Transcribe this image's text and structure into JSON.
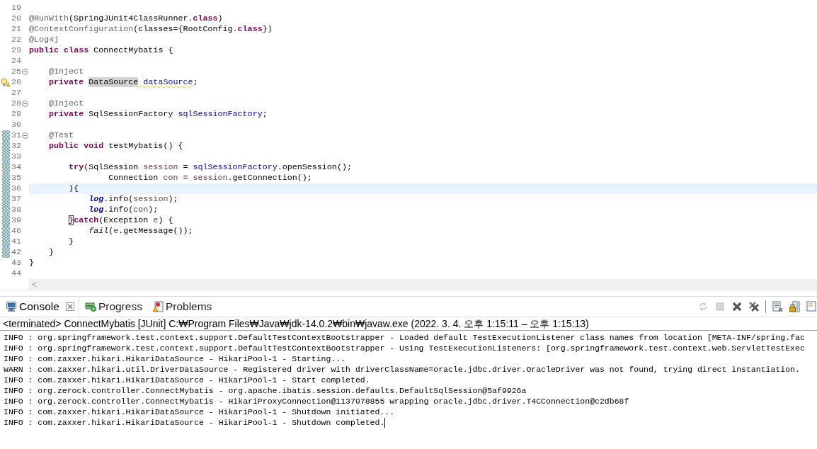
{
  "editor": {
    "lines": [
      {
        "number": "19",
        "kind": "plain",
        "changed": false,
        "current": false,
        "foldable": false
      },
      {
        "number": "20",
        "kind": "plain",
        "changed": false,
        "current": false,
        "foldable": false,
        "tokens": [
          {
            "kind": "annotation",
            "text": "@RunWith"
          },
          {
            "kind": "plain",
            "text": "(SpringJUnit4ClassRunner."
          },
          {
            "kind": "keyword",
            "text": "class"
          },
          {
            "kind": "plain",
            "text": ")"
          }
        ]
      },
      {
        "number": "21",
        "kind": "plain",
        "changed": false,
        "current": false,
        "foldable": false,
        "tokens": [
          {
            "kind": "annotation",
            "text": "@ContextConfiguration"
          },
          {
            "kind": "plain",
            "text": "(classes={RootConfig."
          },
          {
            "kind": "keyword",
            "text": "class"
          },
          {
            "kind": "plain",
            "text": "})"
          }
        ]
      },
      {
        "number": "22",
        "kind": "plain",
        "changed": false,
        "current": false,
        "foldable": false,
        "tokens": [
          {
            "kind": "annotation",
            "text": "@Log4j"
          }
        ]
      },
      {
        "number": "23",
        "kind": "plain",
        "changed": false,
        "current": false,
        "foldable": false,
        "tokens": [
          {
            "kind": "keyword",
            "text": "public "
          },
          {
            "kind": "keyword",
            "text": "class"
          },
          {
            "kind": "plain",
            "text": " ConnectMybatis {"
          }
        ]
      },
      {
        "number": "24",
        "kind": "plain",
        "changed": false,
        "current": false,
        "foldable": false
      },
      {
        "number": "25",
        "kind": "plain",
        "changed": false,
        "current": false,
        "foldable": true,
        "tokens": [
          {
            "kind": "annotation",
            "text": "    @Inject"
          }
        ]
      },
      {
        "number": "26",
        "kind": "warning",
        "changed": false,
        "current": false,
        "foldable": false,
        "tokens": [
          {
            "kind": "keyword",
            "text": "    private "
          },
          {
            "kind": "occurrence",
            "text": "DataSource"
          },
          {
            "kind": "field-warning",
            "text": " dataSource"
          },
          {
            "kind": "plain",
            "text": ";"
          }
        ]
      },
      {
        "number": "27",
        "kind": "plain",
        "changed": false,
        "current": false,
        "foldable": false
      },
      {
        "number": "28",
        "kind": "plain",
        "changed": false,
        "current": false,
        "foldable": true,
        "tokens": [
          {
            "kind": "annotation",
            "text": "    @Inject"
          }
        ]
      },
      {
        "number": "29",
        "kind": "plain",
        "changed": false,
        "current": false,
        "foldable": false,
        "tokens": [
          {
            "kind": "keyword",
            "text": "    private"
          },
          {
            "kind": "plain",
            "text": " SqlSessionFactory "
          },
          {
            "kind": "field",
            "text": "sqlSessionFactory"
          },
          {
            "kind": "plain",
            "text": ";"
          }
        ]
      },
      {
        "number": "30",
        "kind": "plain",
        "changed": false,
        "current": false,
        "foldable": false
      },
      {
        "number": "31",
        "kind": "plain",
        "changed": true,
        "current": false,
        "foldable": true,
        "tokens": [
          {
            "kind": "annotation",
            "text": "    @Test"
          }
        ]
      },
      {
        "number": "32",
        "kind": "plain",
        "changed": true,
        "current": false,
        "foldable": false,
        "tokens": [
          {
            "kind": "keyword",
            "text": "    public "
          },
          {
            "kind": "keyword",
            "text": "void"
          },
          {
            "kind": "plain",
            "text": " testMybatis() {"
          }
        ]
      },
      {
        "number": "33",
        "kind": "plain",
        "changed": true,
        "current": false,
        "foldable": false
      },
      {
        "number": "34",
        "kind": "plain",
        "changed": true,
        "current": false,
        "foldable": false,
        "tokens": [
          {
            "kind": "keyword",
            "text": "        try"
          },
          {
            "kind": "plain",
            "text": "(SqlSession "
          },
          {
            "kind": "local",
            "text": "session"
          },
          {
            "kind": "plain",
            "text": " = "
          },
          {
            "kind": "field",
            "text": "sqlSessionFactory"
          },
          {
            "kind": "plain",
            "text": ".openSession();"
          }
        ]
      },
      {
        "number": "35",
        "kind": "plain",
        "changed": true,
        "current": false,
        "foldable": false,
        "tokens": [
          {
            "kind": "plain",
            "text": "                Connection "
          },
          {
            "kind": "local",
            "text": "con"
          },
          {
            "kind": "plain",
            "text": " = "
          },
          {
            "kind": "local",
            "text": "session"
          },
          {
            "kind": "plain",
            "text": ".getConnection();"
          }
        ]
      },
      {
        "number": "36",
        "kind": "plain",
        "changed": true,
        "current": true,
        "foldable": false,
        "tokens": [
          {
            "kind": "plain",
            "text": "        ){"
          }
        ]
      },
      {
        "number": "37",
        "kind": "plain",
        "changed": true,
        "current": false,
        "foldable": false,
        "tokens": [
          {
            "kind": "static-field",
            "text": "            log"
          },
          {
            "kind": "plain",
            "text": ".info("
          },
          {
            "kind": "local",
            "text": "session"
          },
          {
            "kind": "plain",
            "text": ");"
          }
        ]
      },
      {
        "number": "38",
        "kind": "plain",
        "changed": true,
        "current": false,
        "foldable": false,
        "tokens": [
          {
            "kind": "static-field",
            "text": "            log"
          },
          {
            "kind": "plain",
            "text": ".info("
          },
          {
            "kind": "local",
            "text": "con"
          },
          {
            "kind": "plain",
            "text": ");"
          }
        ]
      },
      {
        "number": "39",
        "kind": "plain",
        "changed": true,
        "current": false,
        "foldable": false,
        "tokens": [
          {
            "kind": "indent-bracket-match",
            "text": "        }"
          },
          {
            "kind": "keyword",
            "text": "catch"
          },
          {
            "kind": "plain",
            "text": "(Exception "
          },
          {
            "kind": "local",
            "text": "e"
          },
          {
            "kind": "plain",
            "text": ") {"
          }
        ]
      },
      {
        "number": "40",
        "kind": "plain",
        "changed": true,
        "current": false,
        "foldable": false,
        "tokens": [
          {
            "kind": "static-method",
            "text": "            fail"
          },
          {
            "kind": "plain",
            "text": "("
          },
          {
            "kind": "local",
            "text": "e"
          },
          {
            "kind": "plain",
            "text": ".getMessage());"
          }
        ]
      },
      {
        "number": "41",
        "kind": "plain",
        "changed": true,
        "current": false,
        "foldable": false,
        "tokens": [
          {
            "kind": "plain",
            "text": "        }"
          }
        ]
      },
      {
        "number": "42",
        "kind": "plain",
        "changed": true,
        "current": false,
        "foldable": false,
        "tokens": [
          {
            "kind": "plain",
            "text": "    }"
          }
        ]
      },
      {
        "number": "43",
        "kind": "plain",
        "changed": false,
        "current": false,
        "foldable": false,
        "tokens": [
          {
            "kind": "plain",
            "text": "}"
          }
        ]
      },
      {
        "number": "44",
        "kind": "plain",
        "changed": false,
        "current": false,
        "foldable": false
      }
    ],
    "scroll_arrow": "<"
  },
  "console": {
    "tabs": [
      {
        "kind": "console",
        "label": "Console",
        "selected": true,
        "closable": true
      },
      {
        "kind": "progress",
        "label": "Progress",
        "selected": false,
        "closable": false
      },
      {
        "kind": "problems",
        "label": "Problems",
        "selected": false,
        "closable": false
      }
    ],
    "toolbar": [
      {
        "kind": "sync",
        "disabled": true
      },
      {
        "kind": "stop",
        "disabled": true
      },
      {
        "kind": "remove",
        "disabled": false
      },
      {
        "kind": "remove-all",
        "disabled": false
      },
      {
        "kind": "separator"
      },
      {
        "kind": "clear",
        "disabled": false
      },
      {
        "kind": "lock",
        "disabled": false
      },
      {
        "kind": "display",
        "disabled": false
      }
    ],
    "process": "<terminated> ConnectMybatis [JUnit] C:₩Program Files₩Java₩jdk-14.0.2₩bin₩javaw.exe  (2022. 3. 4. 오후 1:15:11 – 오후 1:15:13)",
    "output": [
      "INFO : org.springframework.test.context.support.DefaultTestContextBootstrapper - Loaded default TestExecutionListener class names from location [META-INF/spring.fac",
      "INFO : org.springframework.test.context.support.DefaultTestContextBootstrapper - Using TestExecutionListeners: [org.springframework.test.context.web.ServletTestExec",
      "INFO : com.zaxxer.hikari.HikariDataSource - HikariPool-1 - Starting...",
      "WARN : com.zaxxer.hikari.util.DriverDataSource - Registered driver with driverClassName=oracle.jdbc.driver.OracleDriver was not found, trying direct instantiation.",
      "INFO : com.zaxxer.hikari.HikariDataSource - HikariPool-1 - Start completed.",
      "INFO : org.zerock.controller.ConnectMybatis - org.apache.ibatis.session.defaults.DefaultSqlSession@5af9926a",
      "INFO : org.zerock.controller.ConnectMybatis - HikariProxyConnection@1137078855 wrapping oracle.jdbc.driver.T4CConnection@c2db68f",
      "INFO : com.zaxxer.hikari.HikariDataSource - HikariPool-1 - Shutdown initiated...",
      "INFO : com.zaxxer.hikari.HikariDataSource - HikariPool-1 - Shutdown completed."
    ],
    "caret_after_last": true
  }
}
